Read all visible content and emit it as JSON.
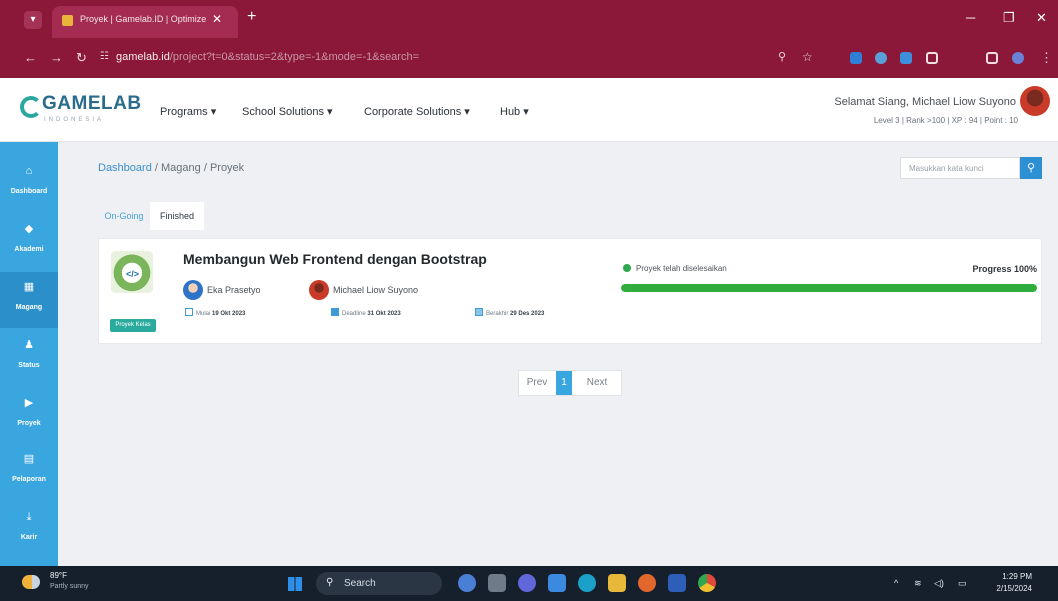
{
  "browser": {
    "tab_title": "Proyek | Gamelab.ID | Optimize",
    "url_host": "gamelab.id",
    "url_path": "/project?t=0&status=2&type=-1&mode=-1&search="
  },
  "site": {
    "logo": "GAMELAB",
    "logo_sub": "INDONESIA",
    "menu": [
      "Programs ▾",
      "School Solutions ▾",
      "Corporate Solutions ▾",
      "Hub ▾"
    ],
    "greeting": "Selamat Siang, Michael Liow Suyono",
    "stats": "Level 3  |  Rank >100  |  XP : 94  |  Point : 10"
  },
  "sidebar": [
    {
      "label": "Dashboard",
      "icon": "home-icon"
    },
    {
      "label": "Akademi",
      "icon": "graduation-icon"
    },
    {
      "label": "Magang",
      "icon": "building-icon"
    },
    {
      "label": "Status",
      "icon": "users-icon"
    },
    {
      "label": "Proyek",
      "icon": "play-icon"
    },
    {
      "label": "Pelaporan",
      "icon": "report-icon"
    },
    {
      "label": "Karir",
      "icon": "download-icon"
    }
  ],
  "breadcrumb": {
    "a": "Dashboard",
    "b": "Magang",
    "c": "Proyek",
    "sep": " / "
  },
  "search": {
    "placeholder": "Masukkan kata kunci"
  },
  "tabs": {
    "ongoing": "On-Going",
    "finished": "Finished"
  },
  "project": {
    "title": "Membangun Web Frontend dengan Bootstrap",
    "label": "Proyek Kelas",
    "mentor": "Eka Prasetyo",
    "member": "Michael Liow Suyono",
    "start_label": "Mulai",
    "start_date": "19 Okt 2023",
    "deadline_label": "Deadline",
    "deadline_date": "31 Okt 2023",
    "end_label": "Berakhir",
    "end_date": "29 Des 2023",
    "status": "Proyek telah diselesaikan",
    "progress_label": "Progress 100%",
    "progress": 1.0
  },
  "pagination": {
    "prev": "Prev",
    "current": "1",
    "next": "Next"
  },
  "taskbar": {
    "temp": "89°F",
    "condition": "Partly sunny",
    "search": "Search",
    "time": "1:29 PM",
    "date": "2/15/2024"
  }
}
